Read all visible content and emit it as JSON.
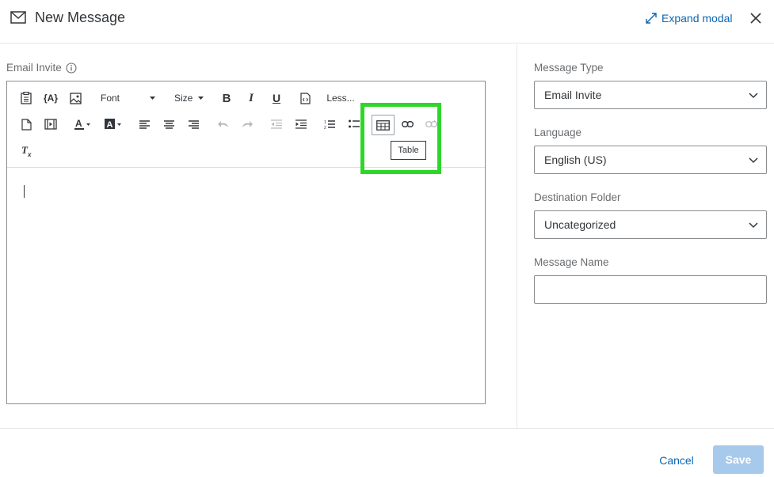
{
  "header": {
    "title": "New Message",
    "expand_label": "Expand modal",
    "mail_icon": "mail-icon",
    "close_icon": "close-icon"
  },
  "editor": {
    "label": "Email Invite",
    "toolbar": {
      "font_label": "Font",
      "size_label": "Size",
      "bold_label": "B",
      "italic_label": "I",
      "underline_label": "U",
      "less_label": "Less...",
      "piped_text_label": "{A}",
      "clear_format_label": "Tx"
    },
    "tooltip": "Table",
    "content": ""
  },
  "settings": {
    "message_type": {
      "label": "Message Type",
      "value": "Email Invite"
    },
    "language": {
      "label": "Language",
      "value": "English (US)"
    },
    "destination_folder": {
      "label": "Destination Folder",
      "value": "Uncategorized"
    },
    "message_name": {
      "label": "Message Name",
      "value": "",
      "placeholder": ""
    }
  },
  "footer": {
    "cancel_label": "Cancel",
    "save_label": "Save"
  },
  "colors": {
    "accent": "#0b66b1",
    "save_disabled": "#a7c9ec",
    "highlight": "#2fd62a"
  }
}
